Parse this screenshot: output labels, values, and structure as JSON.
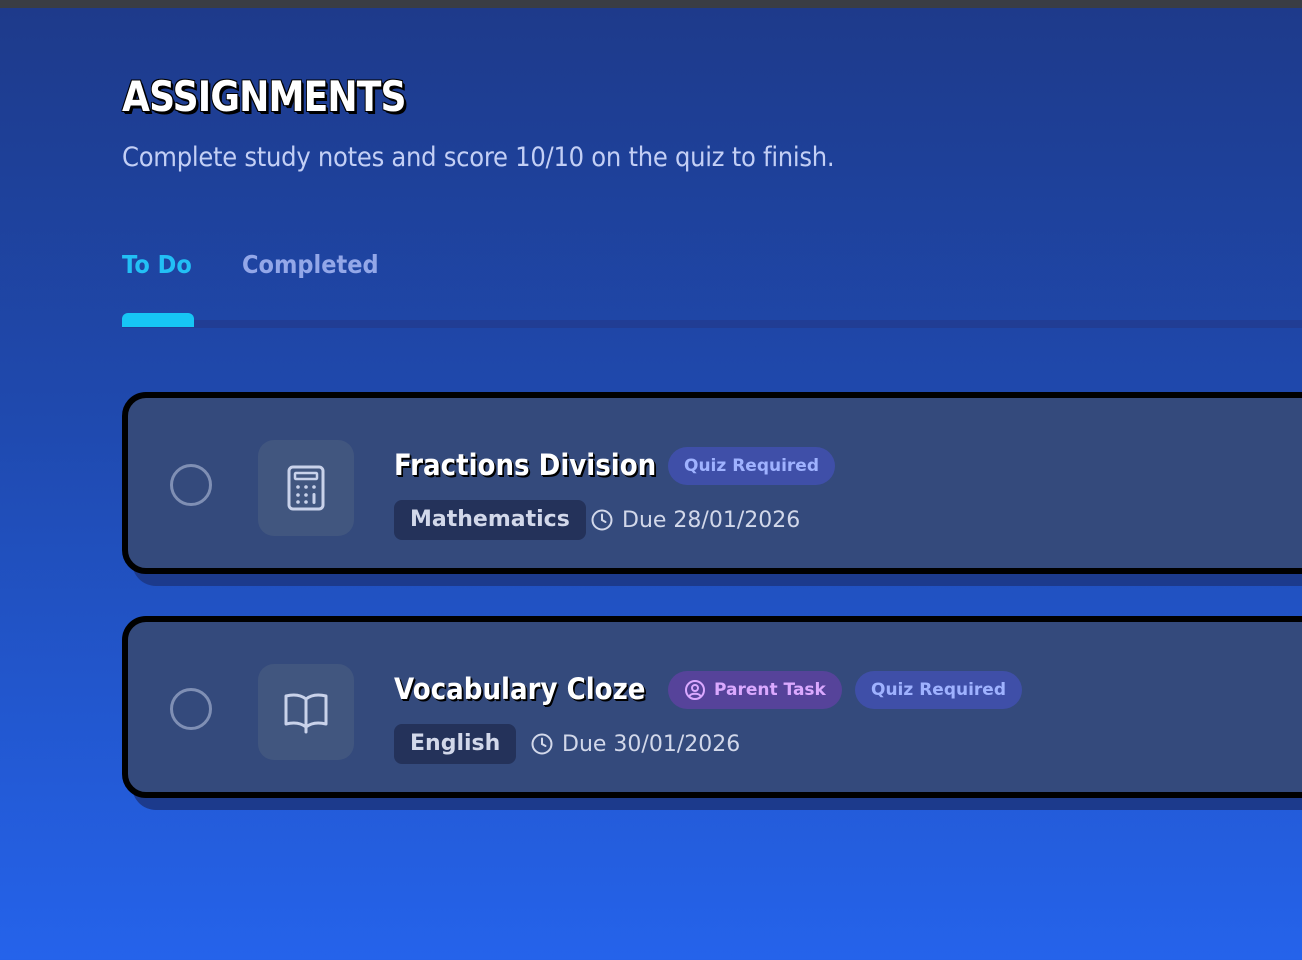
{
  "header": {
    "title": "ASSIGNMENTS",
    "subtitle": "Complete study notes and score 10/10 on the quiz to finish."
  },
  "tabs": [
    {
      "label": "To Do",
      "active": true
    },
    {
      "label": "Completed",
      "active": false
    }
  ],
  "colors": {
    "accent": "#16c6f5",
    "card_bg": "#344a7c",
    "quiz_badge_text": "#9fb2ff",
    "parent_badge_text": "#dba9ff"
  },
  "assignments": [
    {
      "title": "Fractions Division",
      "icon": "calculator-icon",
      "badges": [
        "Quiz Required"
      ],
      "subject": "Mathematics",
      "due": "Due 28/01/2026"
    },
    {
      "title": "Vocabulary Cloze",
      "icon": "book-open-icon",
      "parent_badge": "Parent Task",
      "badges": [
        "Quiz Required"
      ],
      "subject": "English",
      "due": "Due 30/01/2026"
    }
  ]
}
